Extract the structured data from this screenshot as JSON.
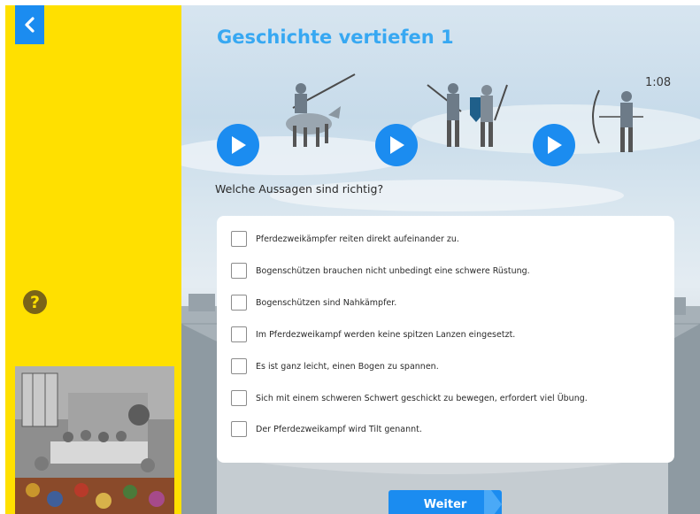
{
  "lesson": {
    "title": "Geschichte vertiefen 1",
    "timer": "1:08",
    "question": "Welche Aussagen sind richtig?",
    "next_label": "Weiter",
    "help_symbol": "?"
  },
  "icons": {
    "back": "chevron-left-icon",
    "help": "question-mark-icon",
    "play": "play-icon"
  },
  "options": [
    "Pferdezweikämpfer reiten direkt aufeinander zu.",
    "Bogenschützen brauchen nicht unbedingt eine schwere Rüstung.",
    "Bogenschützen sind Nahkämpfer.",
    "Im Pferdezweikampf werden keine spitzen Lanzen eingesetzt.",
    "Es ist ganz leicht, einen Bogen zu spannen.",
    "Sich mit einem schweren Schwert geschickt zu bewegen, erfordert viel Übung.",
    "Der Pferdezweikampf wird Tilt genannt."
  ],
  "colors": {
    "sidebar": "#ffe000",
    "accent_blue": "#1b8cf0",
    "title_blue": "#37a8f2",
    "help_brown": "#7a6418"
  }
}
